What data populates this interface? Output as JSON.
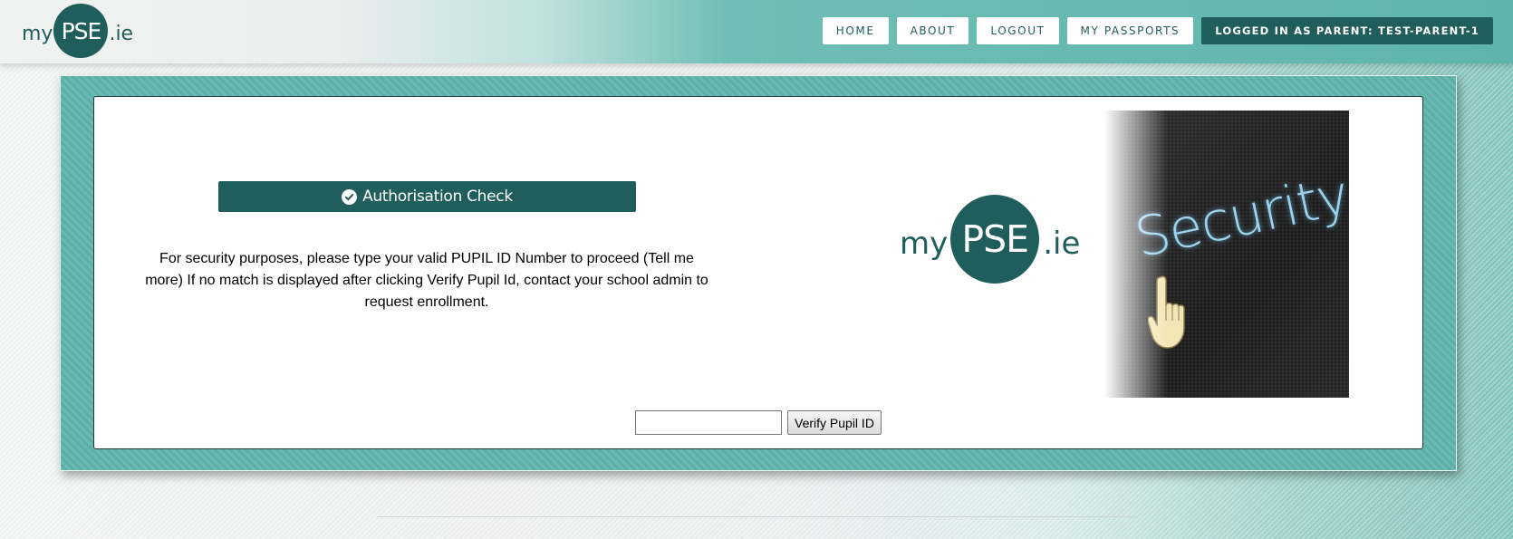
{
  "header": {
    "logo": {
      "pre": "my",
      "mid": "PSE",
      "post": ".ie"
    },
    "nav": [
      {
        "label": "HOME"
      },
      {
        "label": "ABOUT"
      },
      {
        "label": "LOGOUT"
      },
      {
        "label": "MY PASSPORTS"
      }
    ],
    "logged_in_label": "LOGGED IN AS PARENT: TEST-PARENT-1"
  },
  "card": {
    "auth_title": "Authorisation Check",
    "instructions": "For security purposes, please type your valid PUPIL ID Number to proceed (Tell me more) If no match is displayed after clicking Verify Pupil Id, contact your school admin to request enrollment.",
    "logo": {
      "pre": "my",
      "mid": "PSE",
      "post": ".ie"
    },
    "security_image_text": "Security",
    "pupil_input": {
      "value": "",
      "placeholder": ""
    },
    "verify_button": "Verify Pupil ID"
  },
  "colors": {
    "brand_dark": "#1f5e5a",
    "panel_teal": "#5fb5ab"
  },
  "icons": {
    "auth_check": "check-circle-icon",
    "security_cursor": "hand-pointer-icon"
  }
}
